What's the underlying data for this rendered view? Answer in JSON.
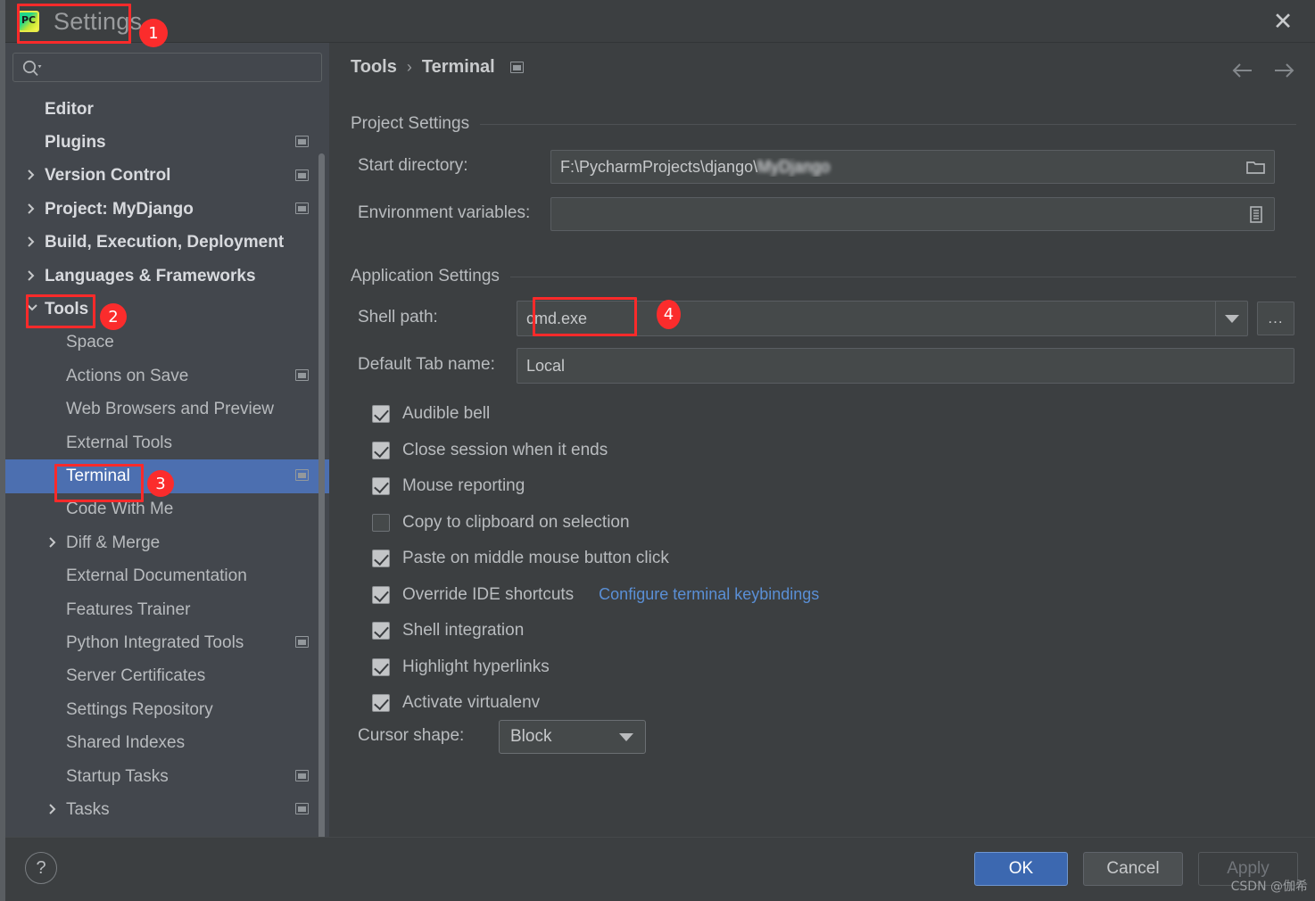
{
  "window": {
    "title": "Settings",
    "app_icon": "pycharm-icon",
    "close_icon": "close-icon"
  },
  "search": {
    "value": "",
    "placeholder": "",
    "icon": "search-icon"
  },
  "sidebar": {
    "items": [
      {
        "label": "Editor",
        "level": 0,
        "bold": true,
        "chevron": "none",
        "scope_icon": false
      },
      {
        "label": "Plugins",
        "level": 0,
        "bold": true,
        "chevron": "none",
        "scope_icon": true
      },
      {
        "label": "Version Control",
        "level": 0,
        "bold": true,
        "chevron": "right",
        "scope_icon": true
      },
      {
        "label": "Project: MyDjango",
        "level": 0,
        "bold": true,
        "chevron": "right",
        "scope_icon": true
      },
      {
        "label": "Build, Execution, Deployment",
        "level": 0,
        "bold": true,
        "chevron": "right",
        "scope_icon": false
      },
      {
        "label": "Languages & Frameworks",
        "level": 0,
        "bold": true,
        "chevron": "right",
        "scope_icon": false
      },
      {
        "label": "Tools",
        "level": 0,
        "bold": true,
        "chevron": "down",
        "scope_icon": false
      },
      {
        "label": "Space",
        "level": 1,
        "bold": false,
        "chevron": "none",
        "scope_icon": false
      },
      {
        "label": "Actions on Save",
        "level": 1,
        "bold": false,
        "chevron": "none",
        "scope_icon": true
      },
      {
        "label": "Web Browsers and Preview",
        "level": 1,
        "bold": false,
        "chevron": "none",
        "scope_icon": false
      },
      {
        "label": "External Tools",
        "level": 1,
        "bold": false,
        "chevron": "none",
        "scope_icon": false
      },
      {
        "label": "Terminal",
        "level": 1,
        "bold": false,
        "chevron": "none",
        "scope_icon": true,
        "selected": true
      },
      {
        "label": "Code With Me",
        "level": 1,
        "bold": false,
        "chevron": "none",
        "scope_icon": false
      },
      {
        "label": "Diff & Merge",
        "level": 1,
        "bold": false,
        "chevron": "right",
        "scope_icon": false
      },
      {
        "label": "External Documentation",
        "level": 1,
        "bold": false,
        "chevron": "none",
        "scope_icon": false
      },
      {
        "label": "Features Trainer",
        "level": 1,
        "bold": false,
        "chevron": "none",
        "scope_icon": false
      },
      {
        "label": "Python Integrated Tools",
        "level": 1,
        "bold": false,
        "chevron": "none",
        "scope_icon": true
      },
      {
        "label": "Server Certificates",
        "level": 1,
        "bold": false,
        "chevron": "none",
        "scope_icon": false
      },
      {
        "label": "Settings Repository",
        "level": 1,
        "bold": false,
        "chevron": "none",
        "scope_icon": false
      },
      {
        "label": "Shared Indexes",
        "level": 1,
        "bold": false,
        "chevron": "none",
        "scope_icon": false
      },
      {
        "label": "Startup Tasks",
        "level": 1,
        "bold": false,
        "chevron": "none",
        "scope_icon": true
      },
      {
        "label": "Tasks",
        "level": 1,
        "bold": false,
        "chevron": "right",
        "scope_icon": true
      }
    ]
  },
  "main": {
    "breadcrumb": {
      "parent": "Tools",
      "separator": "›",
      "current": "Terminal",
      "scope_icon": "project-scope-icon"
    },
    "nav": {
      "back_icon": "arrow-left-icon",
      "forward_icon": "arrow-right-icon"
    },
    "sections": {
      "project_settings": {
        "title": "Project Settings"
      },
      "application_settings": {
        "title": "Application Settings"
      }
    },
    "fields": {
      "start_directory": {
        "label": "Start directory:",
        "value_visible": "F:\\PycharmProjects\\django\\",
        "value_blurred": "MyDjango",
        "browse_icon": "folder-icon"
      },
      "environment_variables": {
        "label": "Environment variables:",
        "value": "",
        "list_icon": "list-icon"
      },
      "shell_path": {
        "label": "Shell path:",
        "value": "cmd.exe",
        "dropdown_icon": "chevron-down-icon",
        "browse_label": "..."
      },
      "default_tab_name": {
        "label": "Default Tab name:",
        "value": "Local"
      },
      "cursor_shape": {
        "label": "Cursor shape:",
        "value": "Block",
        "dropdown_icon": "chevron-down-icon"
      }
    },
    "checkboxes": [
      {
        "label": "Audible bell",
        "checked": true
      },
      {
        "label": "Close session when it ends",
        "checked": true
      },
      {
        "label": "Mouse reporting",
        "checked": true
      },
      {
        "label": "Copy to clipboard on selection",
        "checked": false
      },
      {
        "label": "Paste on middle mouse button click",
        "checked": true
      },
      {
        "label": "Override IDE shortcuts",
        "checked": true,
        "link": "Configure terminal keybindings"
      },
      {
        "label": "Shell integration",
        "checked": true
      },
      {
        "label": "Highlight hyperlinks",
        "checked": true
      },
      {
        "label": "Activate virtualenv",
        "checked": true
      }
    ]
  },
  "footer": {
    "help_label": "?",
    "ok_label": "OK",
    "cancel_label": "Cancel",
    "apply_label": "Apply",
    "watermark": "CSDN @伽希"
  },
  "annotations": {
    "badges": [
      {
        "number": "1"
      },
      {
        "number": "2"
      },
      {
        "number": "3"
      },
      {
        "number": "4"
      }
    ],
    "accent_color": "#fb2c2c"
  }
}
